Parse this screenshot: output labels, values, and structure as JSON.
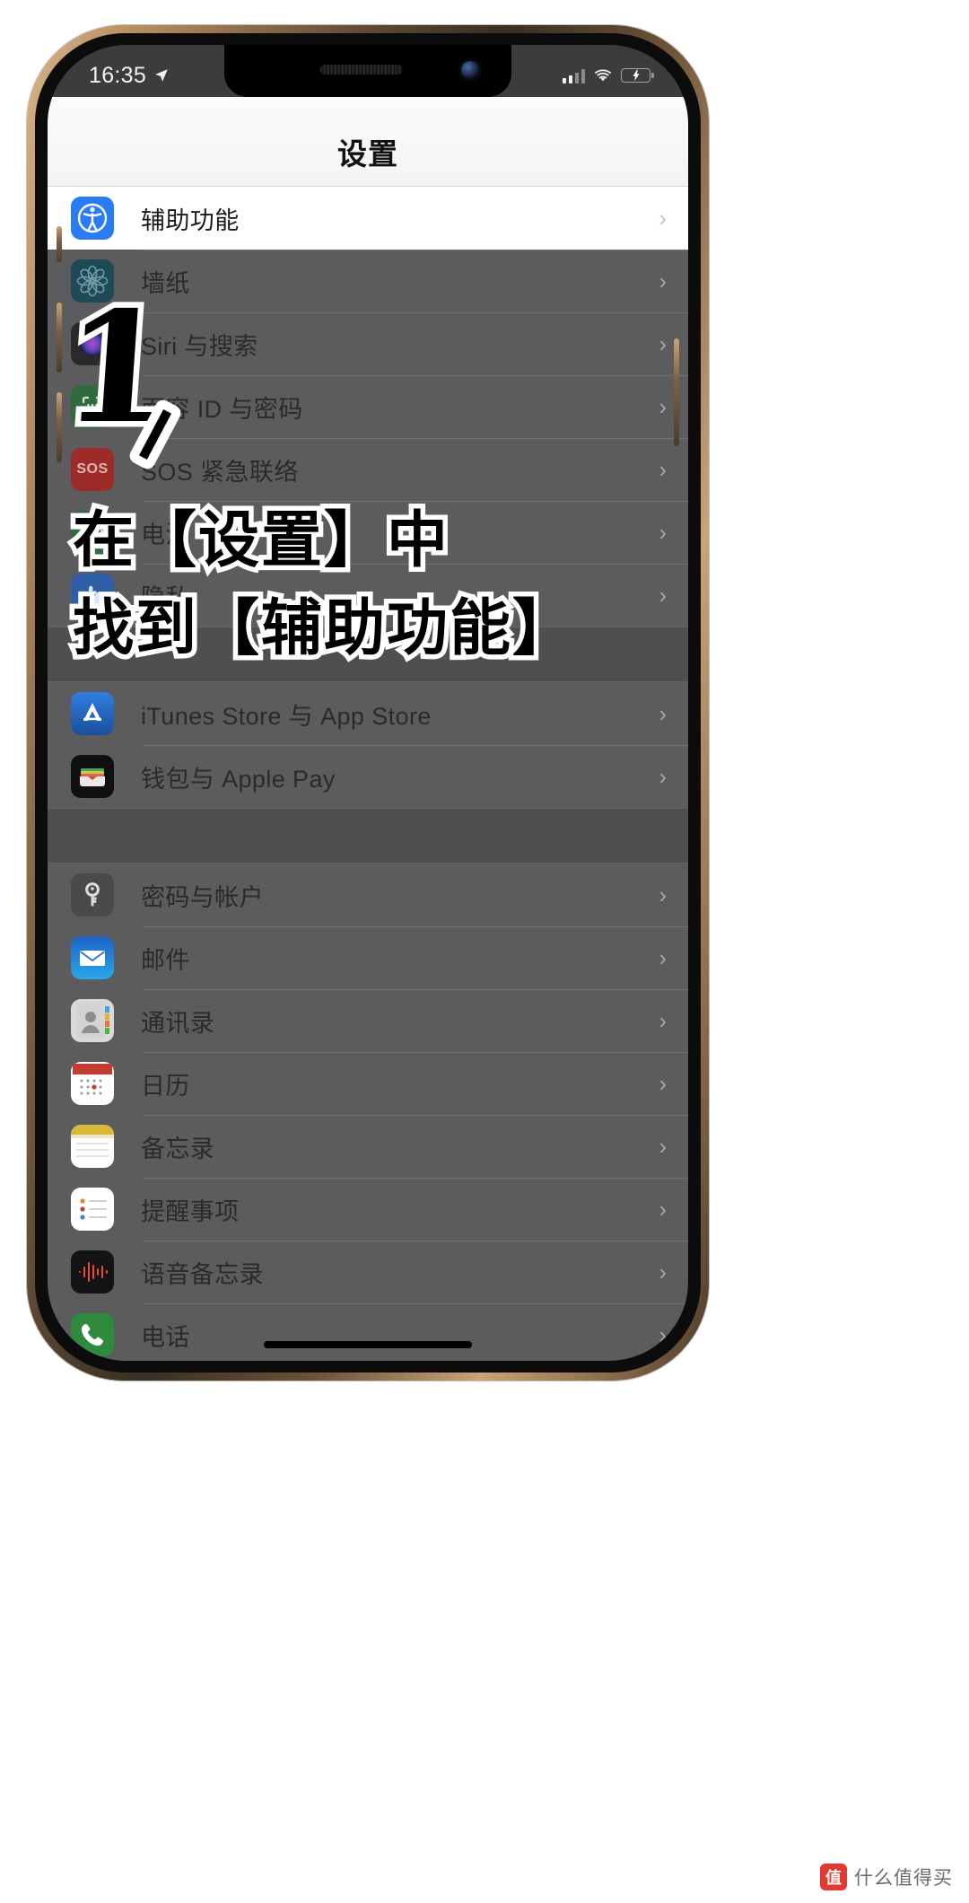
{
  "status_bar": {
    "time": "16:35",
    "location_icon": "location-arrow-icon",
    "signal_icon": "cellular-bars-icon",
    "wifi_icon": "wifi-icon",
    "battery_icon": "battery-charging-icon"
  },
  "nav": {
    "title": "设置"
  },
  "groups": [
    {
      "rows": [
        {
          "label": "辅助功能",
          "icon": "accessibility-icon",
          "icon_class": "ic-access",
          "highlight": true
        },
        {
          "label": "墙纸",
          "icon": "wallpaper-icon",
          "icon_class": "ic-wall",
          "highlight": false
        },
        {
          "label": "Siri 与搜索",
          "icon": "siri-icon",
          "icon_class": "ic-siri",
          "highlight": false
        },
        {
          "label": "面容 ID 与密码",
          "icon": "faceid-icon",
          "icon_class": "ic-faceid",
          "highlight": false
        },
        {
          "label": "SOS 紧急联络",
          "icon": "sos-icon",
          "icon_class": "ic-sos",
          "highlight": false
        },
        {
          "label": "电池",
          "icon": "battery-icon",
          "icon_class": "ic-batt",
          "highlight": false
        },
        {
          "label": "隐私",
          "icon": "privacy-hand-icon",
          "icon_class": "ic-privacy",
          "highlight": false
        }
      ]
    },
    {
      "rows": [
        {
          "label": "iTunes Store 与 App Store",
          "icon": "appstore-icon",
          "icon_class": "ic-itunes",
          "highlight": false
        },
        {
          "label": "钱包与 Apple Pay",
          "icon": "wallet-icon",
          "icon_class": "ic-wallet",
          "highlight": false
        }
      ]
    },
    {
      "rows": [
        {
          "label": "密码与帐户",
          "icon": "key-icon",
          "icon_class": "ic-pwd",
          "highlight": false
        },
        {
          "label": "邮件",
          "icon": "mail-icon",
          "icon_class": "ic-mail",
          "highlight": false
        },
        {
          "label": "通讯录",
          "icon": "contacts-icon",
          "icon_class": "ic-contacts",
          "highlight": false
        },
        {
          "label": "日历",
          "icon": "calendar-icon",
          "icon_class": "ic-cal",
          "highlight": false
        },
        {
          "label": "备忘录",
          "icon": "notes-icon",
          "icon_class": "ic-notes",
          "highlight": false
        },
        {
          "label": "提醒事项",
          "icon": "reminders-icon",
          "icon_class": "ic-remind",
          "highlight": false
        },
        {
          "label": "语音备忘录",
          "icon": "voice-memos-icon",
          "icon_class": "ic-voice",
          "highlight": false
        },
        {
          "label": "电话",
          "icon": "phone-icon",
          "icon_class": "ic-phone",
          "highlight": false
        }
      ]
    }
  ],
  "chevron": "›",
  "annotations": {
    "step_number": "1",
    "caption_line1": "在【设置】中",
    "caption_line2": "找到【辅助功能】"
  },
  "watermark": {
    "badge": "值",
    "text": "什么值得买"
  },
  "colors": {
    "accent_blue": "#2a7cf6",
    "battery_green": "#32d74b",
    "sos_red": "#9d2b27",
    "watermark_red": "#e03a32"
  }
}
